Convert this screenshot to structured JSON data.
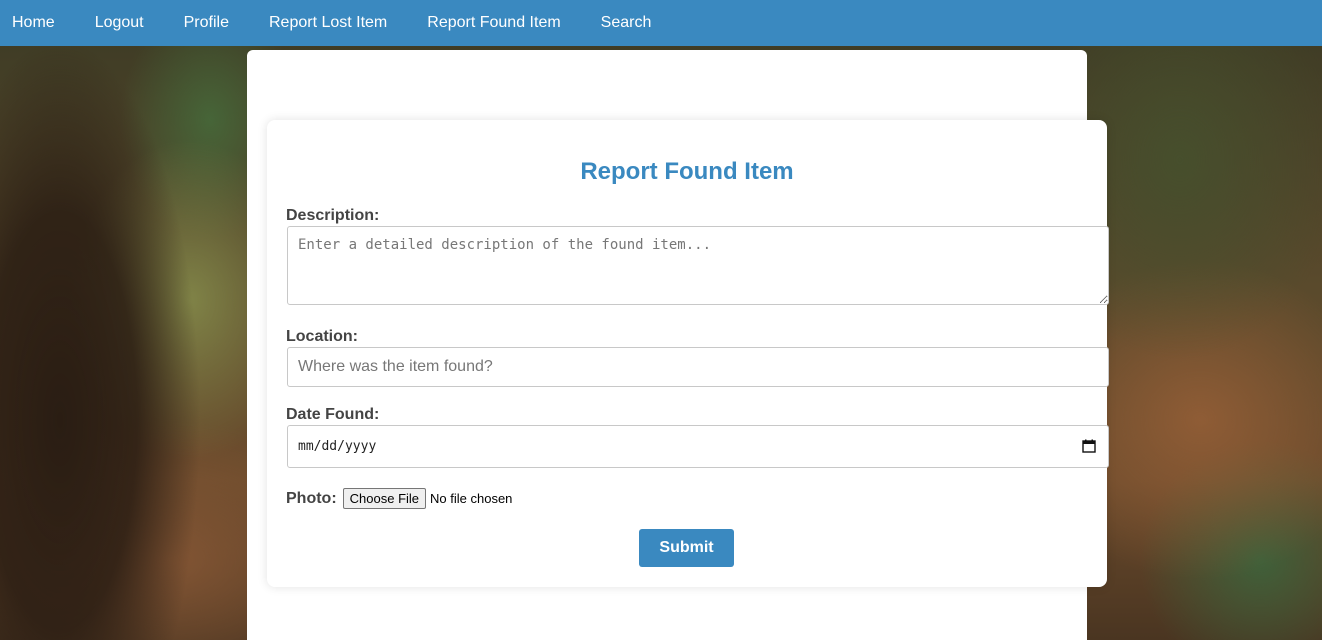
{
  "nav": {
    "items": [
      {
        "label": "Home"
      },
      {
        "label": "Logout"
      },
      {
        "label": "Profile"
      },
      {
        "label": "Report Lost Item"
      },
      {
        "label": "Report Found Item"
      },
      {
        "label": "Search"
      }
    ]
  },
  "form": {
    "title": "Report Found Item",
    "description": {
      "label": "Description:",
      "placeholder": "Enter a detailed description of the found item...",
      "value": ""
    },
    "location": {
      "label": "Location:",
      "placeholder": "Where was the item found?",
      "value": ""
    },
    "date_found": {
      "label": "Date Found:",
      "value_display": "mm/dd/yyyy"
    },
    "photo": {
      "label": "Photo:",
      "button_label": "Choose File",
      "status": "No file chosen"
    },
    "submit_label": "Submit"
  },
  "colors": {
    "accent": "#3a89c0",
    "label_text": "#444444"
  }
}
